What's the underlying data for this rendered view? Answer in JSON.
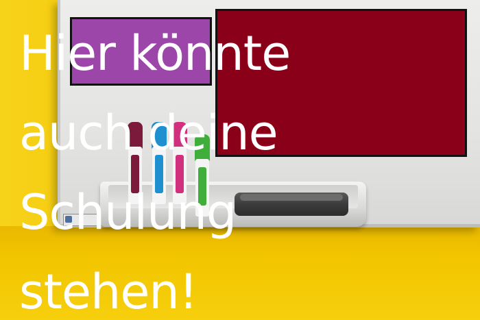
{
  "headline": {
    "text": "Hier könnte\nauch deine\nSchulung\nstehen!",
    "color": "#ffffff"
  },
  "colors": {
    "background_yellow": "#f2c400",
    "whiteboard": "#e6e6e4",
    "purple_panel": "#9b46a8",
    "red_panel": "#8a0018",
    "panel_border": "#111111"
  },
  "markers": [
    {
      "color": "#7b1a3a"
    },
    {
      "color": "#1e8fcf"
    },
    {
      "color": "#d0307e"
    },
    {
      "color": "#3fae3a"
    }
  ]
}
